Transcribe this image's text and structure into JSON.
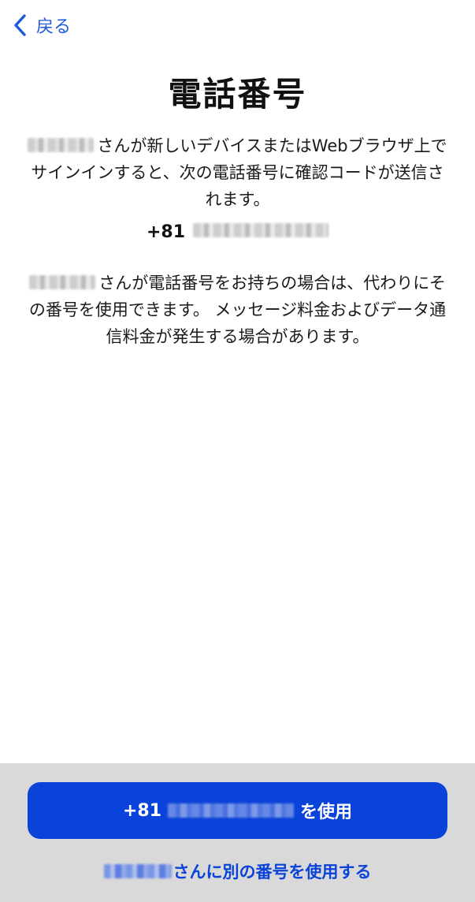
{
  "nav": {
    "back_label": "戻る"
  },
  "header": {
    "title": "電話番号"
  },
  "body": {
    "para1_text": "さんが新しいデバイスまたはWebブラウザ上でサインインすると、次の電話番号に確認コードが送信されます。",
    "phone_prefix": "+81",
    "para2_text": "さんが電話番号をお持ちの場合は、代わりにその番号を使用できます。 メッセージ料金およびデータ通信料金が発生する場合があります。"
  },
  "actions": {
    "primary_prefix": "+81",
    "primary_suffix": "を使用",
    "secondary_suffix": "さんに別の番号を使用する"
  },
  "colors": {
    "accent": "#0a43d9",
    "link": "#1f5bd6",
    "sheet_bg": "#d9d9d9"
  },
  "icons": {
    "back": "chevron-left-icon"
  }
}
